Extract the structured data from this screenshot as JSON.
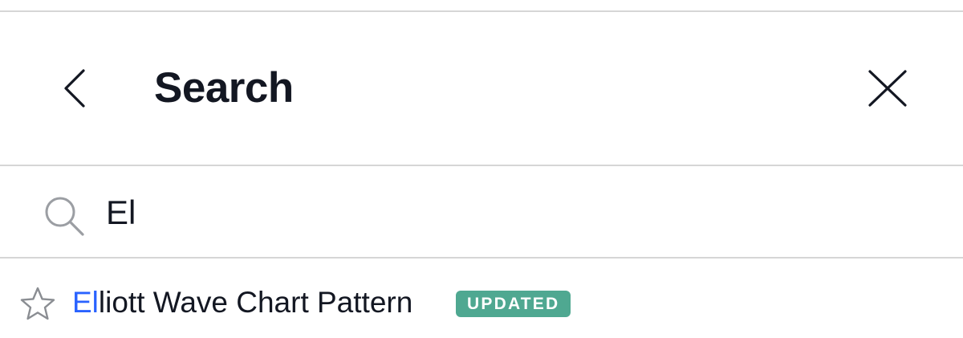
{
  "header": {
    "title": "Search",
    "back_icon": "chevron-left-icon",
    "close_icon": "close-icon"
  },
  "search": {
    "icon": "search-icon",
    "value": "El",
    "placeholder": ""
  },
  "results": [
    {
      "icon": "star-outline-icon",
      "match": "El",
      "rest": "liott Wave Chart Pattern",
      "badge": "UPDATED"
    }
  ],
  "colors": {
    "text": "#131722",
    "highlight": "#2962ff",
    "badge_bg": "#4fa891",
    "divider": "#d6d6d6",
    "icon_gray": "#9b9ea3"
  }
}
